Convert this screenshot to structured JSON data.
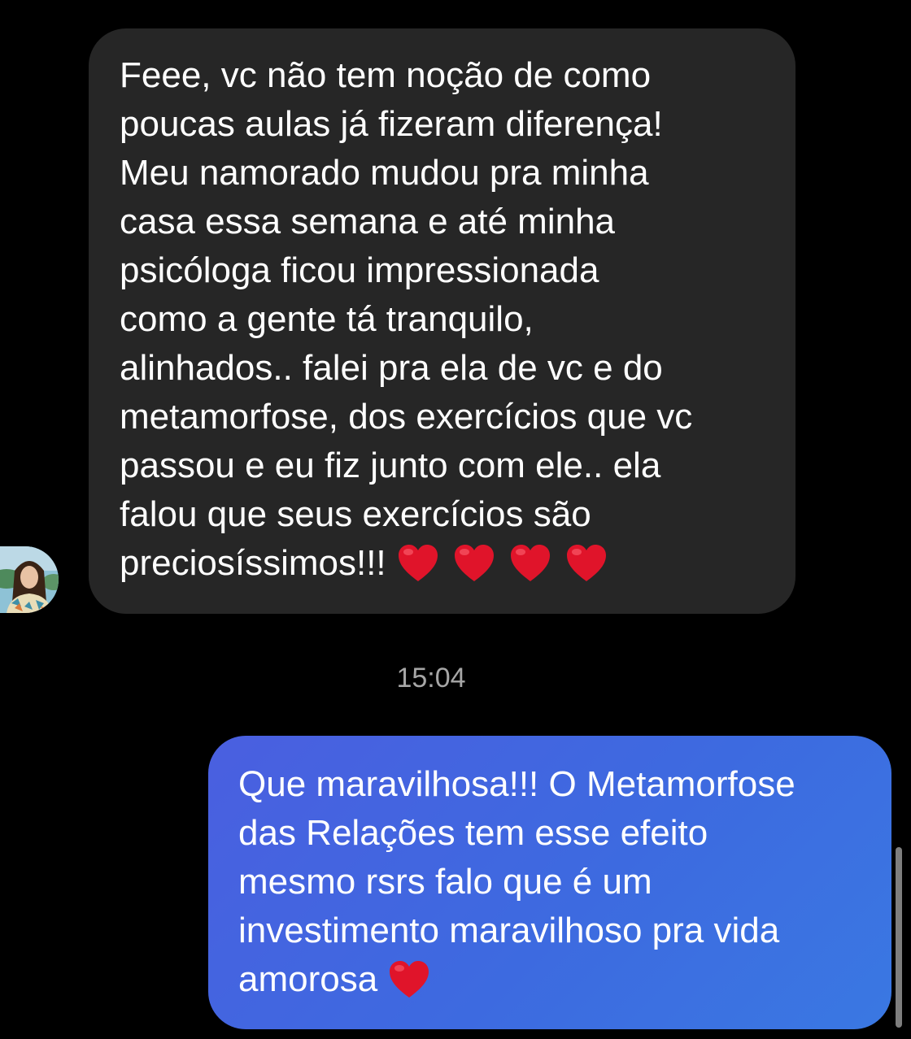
{
  "incoming_message": {
    "lines": [
      "Feee, vc não tem noção de como",
      "poucas aulas já fizeram diferença!",
      "Meu namorado mudou pra minha",
      "casa essa semana e até minha",
      "psicóloga ficou impressionada",
      "como a gente tá tranquilo,",
      "alinhados.. falei pra ela de vc e do",
      "metamorfose, dos exercícios que vc",
      "passou e eu fiz junto com ele.. ela",
      "falou que seus exercícios são",
      "preciosíssimos!!!"
    ],
    "reaction_icons": [
      "heart-icon",
      "heart-icon",
      "heart-icon",
      "heart-icon"
    ],
    "bubble_color": "#262626"
  },
  "timestamp": "15:04",
  "outgoing_message": {
    "lines": [
      "Que maravilhosa!!! O Metamorfose",
      "das Relações tem esse efeito",
      "mesmo rsrs falo que é um",
      "investimento maravilhoso pra vida",
      "amorosa"
    ],
    "reaction_icons": [
      "heart-icon"
    ],
    "bubble_color": "#4266e1"
  },
  "colors": {
    "background": "#000000",
    "text": "#ffffff",
    "timestamp": "#a6a6a6",
    "heart": "#e0142a"
  }
}
